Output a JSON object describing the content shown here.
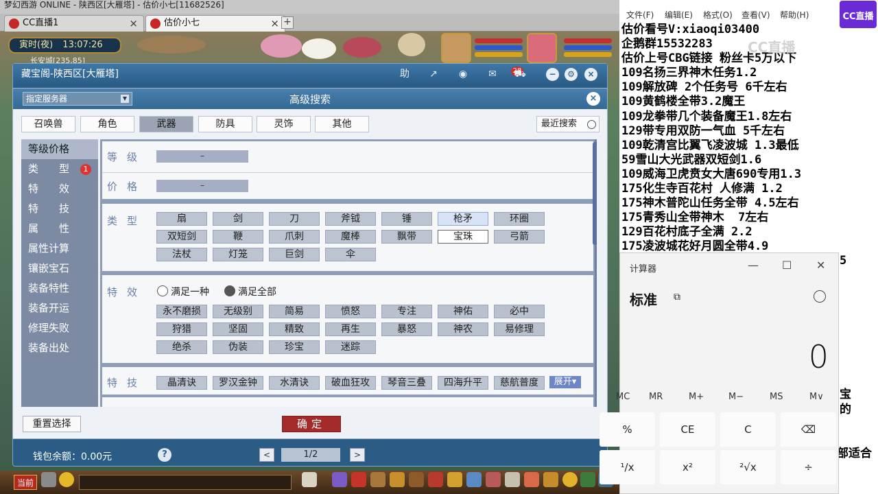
{
  "browser": {
    "window_title": "梦幻西游 ONLINE - 陕西区[大雁塔] - 估价小七[11682526]",
    "tabs": [
      {
        "label": "CC直播1"
      },
      {
        "label": "估价小七"
      }
    ],
    "new_tab_symbol": "+",
    "close_symbol": "×"
  },
  "game": {
    "clock_period": "寅时(夜)",
    "clock_time": "13:07:26",
    "location": "长安城[235,85]",
    "bottom_left_button": "当前"
  },
  "main_window": {
    "title": "藏宝阁-陕西区[大雁塔]",
    "help_label": "助",
    "message_count": "28",
    "wallet_text": "钱包余额：0.00元",
    "help_symbol": "?",
    "page": "1/2",
    "prev_symbol": "<",
    "next_symbol": ">"
  },
  "dialog": {
    "title": "高级搜索",
    "server_select": "指定服务器",
    "close_symbol": "×",
    "categories": [
      "召唤兽",
      "角色",
      "武器",
      "防具",
      "灵饰",
      "其他"
    ],
    "selected_category": "武器",
    "recent_search": "最近搜索",
    "left_menu": [
      "等级价格",
      "类　　型",
      "特　　效",
      "特　　技",
      "属　　性",
      "属性计算",
      "镶嵌宝石",
      "装备特性",
      "装备开运",
      "修理失败",
      "装备出处"
    ],
    "type_badge": "1",
    "level_label": "等级",
    "level_range": "–",
    "price_label": "价格",
    "price_range": "–",
    "type_label": "类型",
    "types": [
      "扇",
      "剑",
      "刀",
      "斧钺",
      "锤",
      "枪矛",
      "环圈",
      "双短剑",
      "鞭",
      "爪刺",
      "魔棒",
      "飘带",
      "宝珠",
      "弓箭",
      "法杖",
      "灯笼",
      "巨剑",
      "伞"
    ],
    "effect_label": "特效",
    "effect_option_one": "满足一种",
    "effect_option_all": "满足全部",
    "effects": [
      "永不磨损",
      "无级别",
      "简易",
      "愤怒",
      "专注",
      "神佑",
      "必中",
      "狩猎",
      "坚固",
      "精致",
      "再生",
      "暴怒",
      "神农",
      "易修理",
      "绝杀",
      "伪装",
      "珍宝",
      "迷踪"
    ],
    "skill_label": "特技",
    "skills": [
      "晶清诀",
      "罗汉金钟",
      "水清诀",
      "破血狂攻",
      "琴音三叠",
      "四海升平",
      "慈航普度"
    ],
    "expand_label": "展开▾",
    "reset_button": "重置选择",
    "ok_button": "确定"
  },
  "notepad": {
    "menu": [
      "文件(F)",
      "编辑(E)",
      "格式(O)",
      "查看(V)",
      "帮助(H)"
    ],
    "lines": [
      "估价看号V:xiaoqi03400",
      "企鹅群15532283",
      "估价上号CBG链接 粉丝卡5万以下",
      "109名扬三界神木任务1.2",
      "109解放碑 2个任务号 6千左右",
      "109黄鹤楼全带3.2魔王",
      "109龙拳带几个装备魔王1.8左右",
      "129带专用双防一气血 5千左右",
      "109乾清宫比翼飞凌波城 1.3最低",
      "59雪山大光武器双短剑1.6",
      "109威海卫虎贲女大唐690专用1.3",
      "175化生寺百花村 人修满 1.2",
      "175神木普陀山任务全带 4.5左右",
      "175青秀山全带神木  7左右",
      "129百花村底子全满 2.2",
      "175凌波城花好月圆全带4.9"
    ],
    "tail_chars": [
      "5",
      "宝",
      "的",
      "部适合"
    ],
    "logo": "CC直播",
    "watermark": "CC直播"
  },
  "calculator": {
    "title": "计算器",
    "mode": "标准",
    "display": "0",
    "memory": [
      "MC",
      "MR",
      "M+",
      "M−",
      "MS",
      "M∨"
    ],
    "keys_row1": [
      "%",
      "CE",
      "C",
      "⌫"
    ],
    "keys_row2": [
      "¹/x",
      "x²",
      "²√x",
      "÷"
    ],
    "minimize": "—",
    "maximize": "☐",
    "close": "✕"
  }
}
